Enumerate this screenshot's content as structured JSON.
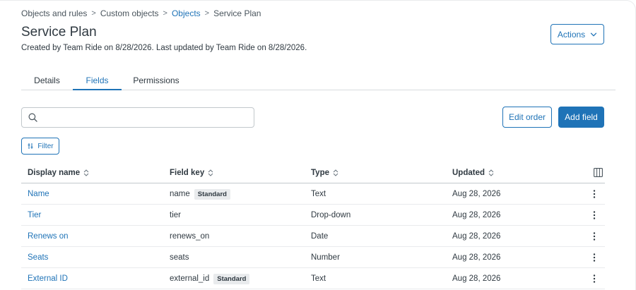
{
  "breadcrumb": [
    {
      "label": "Objects and rules",
      "link": false
    },
    {
      "label": "Custom objects",
      "link": false
    },
    {
      "label": "Objects",
      "link": true
    },
    {
      "label": "Service Plan",
      "link": false
    }
  ],
  "breadcrumb_separator": ">",
  "page": {
    "title": "Service Plan",
    "subtitle": "Created by Team Ride on 8/28/2026. Last updated by Team Ride on 8/28/2026."
  },
  "actions_button": {
    "label": "Actions",
    "icon": "chevron-down-icon"
  },
  "tabs": [
    {
      "label": "Details",
      "active": false
    },
    {
      "label": "Fields",
      "active": true
    },
    {
      "label": "Permissions",
      "active": false
    }
  ],
  "search": {
    "value": "",
    "placeholder": "",
    "icon": "search-icon"
  },
  "toolbar": {
    "edit_order_label": "Edit order",
    "add_field_label": "Add field",
    "filter_label": "Filter"
  },
  "table": {
    "columns": [
      {
        "label": "Display name",
        "sortable": true
      },
      {
        "label": "Field key",
        "sortable": true
      },
      {
        "label": "Type",
        "sortable": true
      },
      {
        "label": "Updated",
        "sortable": true
      }
    ],
    "rows": [
      {
        "display_name": "Name",
        "field_key": "name",
        "badge": "Standard",
        "type": "Text",
        "updated": "Aug 28, 2026"
      },
      {
        "display_name": "Tier",
        "field_key": "tier",
        "badge": "",
        "type": "Drop-down",
        "updated": "Aug 28, 2026"
      },
      {
        "display_name": "Renews on",
        "field_key": "renews_on",
        "badge": "",
        "type": "Date",
        "updated": "Aug 28, 2026"
      },
      {
        "display_name": "Seats",
        "field_key": "seats",
        "badge": "",
        "type": "Number",
        "updated": "Aug 28, 2026"
      },
      {
        "display_name": "External ID",
        "field_key": "external_id",
        "badge": "Standard",
        "type": "Text",
        "updated": "Aug 28, 2026"
      }
    ]
  },
  "colors": {
    "accent": "#1f73b7",
    "text": "#2f3941",
    "border": "#c2c8cc",
    "badge_bg": "#e9ebed"
  }
}
